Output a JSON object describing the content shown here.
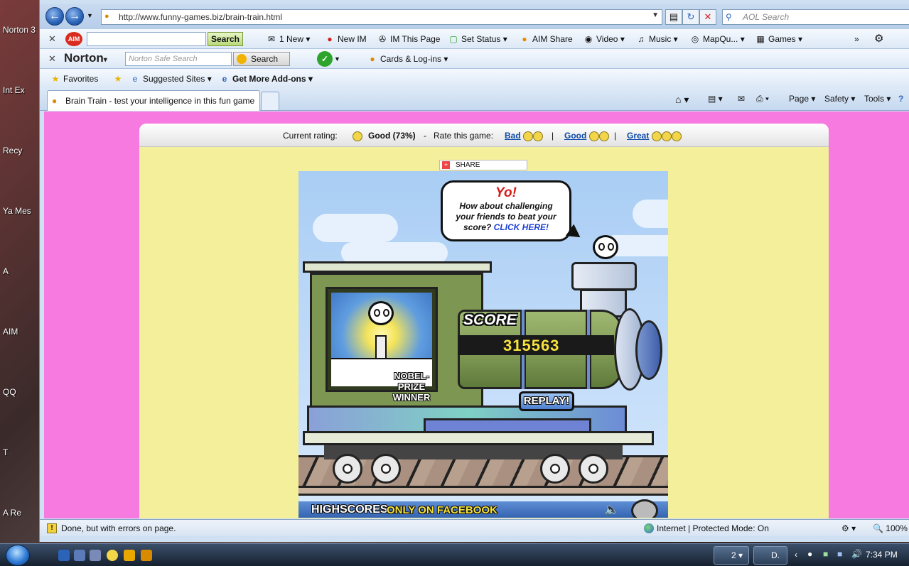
{
  "desktop": {
    "icons": [
      "Norton 3",
      "Int Ex",
      "Recy",
      "Ya Mes",
      "A",
      "AIM",
      "QQ",
      "T",
      "A Re"
    ]
  },
  "browser": {
    "address_url": "http://www.funny-games.biz/brain-train.html",
    "search_placeholder": "AOL Search",
    "aim_toolbar": {
      "search_label": "Search",
      "items": [
        "1 New",
        "New IM",
        "IM This Page",
        "Set Status",
        "AIM Share",
        "Video",
        "Music",
        "MapQu...",
        "Games"
      ]
    },
    "norton_toolbar": {
      "brand": "Norton",
      "search_placeholder": "Norton Safe Search",
      "search_label": "Search",
      "cards_label": "Cards & Log-ins"
    },
    "favorites_bar": {
      "favorites": "Favorites",
      "suggested": "Suggested Sites",
      "addons": "Get More Add-ons"
    },
    "tab": {
      "title": "Brain Train - test your intelligence in this fun game"
    },
    "command_bar": {
      "page": "Page",
      "safety": "Safety",
      "tools": "Tools"
    },
    "status": {
      "message": "Done, but with errors on page.",
      "zone": "Internet | Protected Mode: On",
      "zoom": "100%"
    }
  },
  "page": {
    "rating": {
      "current_label": "Current rating:",
      "current_value": "Good (73%)",
      "rate_label": "Rate this game:",
      "bad": "Bad",
      "good": "Good",
      "great": "Great",
      "separator": "|",
      "dash": "-"
    },
    "share": "SHARE",
    "game": {
      "bubble_title": "Yo!",
      "bubble_text": "How about challenging your friends to beat your score?",
      "bubble_link": "CLICK HERE!",
      "score_label": "SCORE",
      "score_value": "315563",
      "nobel_label": "NOBEL-PRIZE WINNER",
      "replay": "REPLAY!",
      "highscores": "HIGHSCORES",
      "facebook": "ONLY ON FACEBOOK"
    }
  },
  "taskbar": {
    "group_count": "2",
    "doc_button": "D.",
    "time": "7:34 PM"
  }
}
